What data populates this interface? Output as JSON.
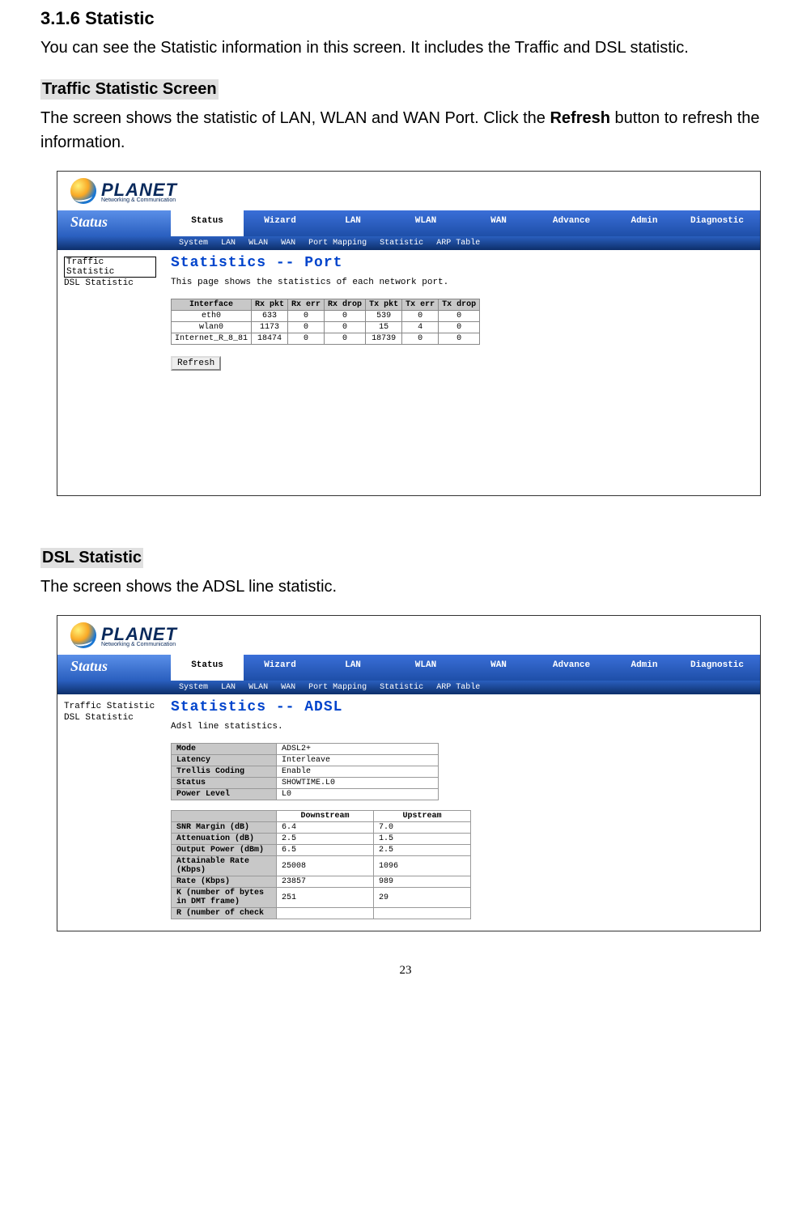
{
  "doc": {
    "heading_num": "3.1.6",
    "heading_text": "Statistic",
    "intro": "You can see the Statistic information in this screen. It includes the Traffic and DSL statistic.",
    "traffic_heading": "Traffic Statistic Screen",
    "traffic_desc_pre": "The screen shows the statistic of LAN, WLAN and WAN Port. Click the ",
    "traffic_desc_bold": "Refresh",
    "traffic_desc_post": " button to refresh the information.",
    "dsl_heading": "DSL Statistic",
    "dsl_desc": "The screen shows the ADSL line statistic.",
    "page_number": "23"
  },
  "brand": {
    "name": "PLANET",
    "tagline": "Networking & Communication"
  },
  "nav": {
    "status_label": "Status",
    "tabs": [
      "Status",
      "Wizard",
      "LAN",
      "WLAN",
      "WAN",
      "Advance",
      "Admin",
      "Diagnostic"
    ],
    "subnav": [
      "System",
      "LAN",
      "WLAN",
      "WAN",
      "Port Mapping",
      "Statistic",
      "ARP Table"
    ]
  },
  "shot1": {
    "side_items": [
      "Traffic Statistic",
      "DSL Statistic"
    ],
    "side_selected_index": 0,
    "title": "Statistics -- Port",
    "desc": "This page shows the statistics of each network port.",
    "columns": [
      "Interface",
      "Rx pkt",
      "Rx err",
      "Rx drop",
      "Tx pkt",
      "Tx err",
      "Tx drop"
    ],
    "rows": [
      [
        "eth0",
        "633",
        "0",
        "0",
        "539",
        "0",
        "0"
      ],
      [
        "wlan0",
        "1173",
        "0",
        "0",
        "15",
        "4",
        "0"
      ],
      [
        "Internet_R_8_81",
        "18474",
        "0",
        "0",
        "18739",
        "0",
        "0"
      ]
    ],
    "refresh_label": "Refresh"
  },
  "shot2": {
    "side_items": [
      "Traffic Statistic",
      "DSL Statistic"
    ],
    "side_selected_index": 1,
    "title": "Statistics -- ADSL",
    "desc": "Adsl line statistics.",
    "kv": [
      [
        "Mode",
        "ADSL2+"
      ],
      [
        "Latency",
        "Interleave"
      ],
      [
        "Trellis Coding",
        "Enable"
      ],
      [
        "Status",
        "SHOWTIME.L0"
      ],
      [
        "Power Level",
        "L0"
      ]
    ],
    "dir_headers": [
      "",
      "Downstream",
      "Upstream"
    ],
    "dir_rows": [
      [
        "SNR Margin (dB)",
        "6.4",
        "7.0"
      ],
      [
        "Attenuation (dB)",
        "2.5",
        "1.5"
      ],
      [
        "Output Power (dBm)",
        "6.5",
        "2.5"
      ],
      [
        "Attainable Rate (Kbps)",
        "25008",
        "1096"
      ],
      [
        "Rate (Kbps)",
        "23857",
        "989"
      ],
      [
        "K (number of bytes in DMT frame)",
        "251",
        "29"
      ],
      [
        "R (number of check",
        "",
        ""
      ]
    ]
  }
}
